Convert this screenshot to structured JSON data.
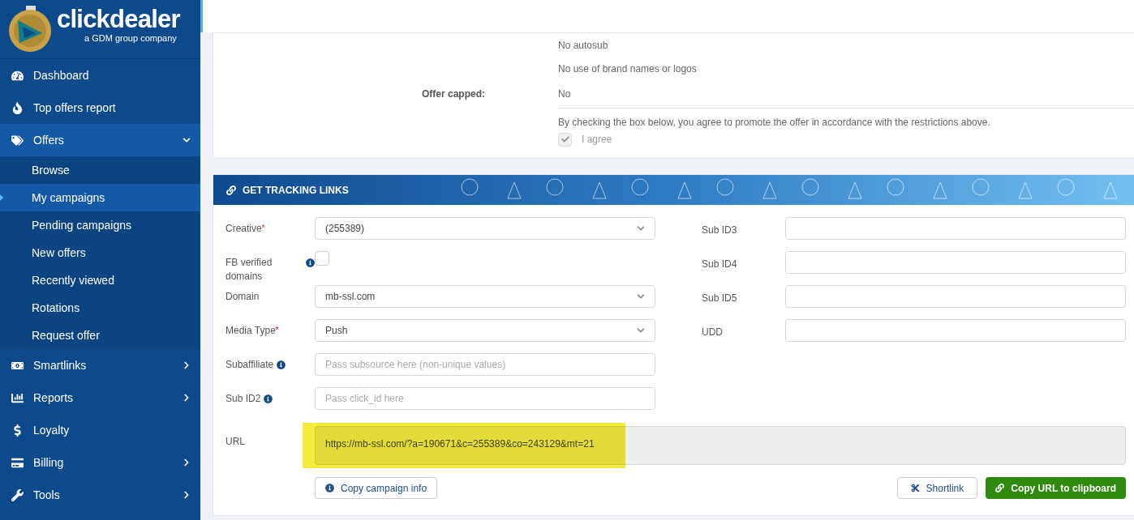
{
  "sidebar": {
    "logo": {
      "name": "clickdealer",
      "tagline": "a GDM group company"
    },
    "items": [
      {
        "label": "Dashboard",
        "kind": "link"
      },
      {
        "label": "Top offers report",
        "kind": "link"
      },
      {
        "label": "Offers",
        "kind": "group",
        "expanded": true,
        "children": [
          {
            "label": "Browse",
            "selected": false
          },
          {
            "label": "My campaigns",
            "selected": true
          },
          {
            "label": "Pending campaigns",
            "selected": false
          },
          {
            "label": "New offers",
            "selected": false
          },
          {
            "label": "Recently viewed",
            "selected": false
          },
          {
            "label": "Rotations",
            "selected": false
          },
          {
            "label": "Request offer",
            "selected": false
          }
        ]
      },
      {
        "label": "Smartlinks",
        "kind": "group",
        "expanded": false
      },
      {
        "label": "Reports",
        "kind": "group",
        "expanded": false
      },
      {
        "label": "Loyalty",
        "kind": "link"
      },
      {
        "label": "Billing",
        "kind": "group",
        "expanded": false
      },
      {
        "label": "Tools",
        "kind": "group",
        "expanded": false
      }
    ]
  },
  "offer_details": {
    "restrictions": [
      "No autosub",
      "No use of brand names or logos"
    ],
    "offer_capped": {
      "label": "Offer capped:",
      "value": "No"
    },
    "agreement": {
      "text": "By checking the box below, you agree to promote the offer in accordance with the restrictions above.",
      "checkbox_label": "I agree",
      "checked": true,
      "disabled": true
    }
  },
  "tracking_links": {
    "title": "GET TRACKING LINKS",
    "left_fields": [
      {
        "label": "Creative",
        "kind": "select",
        "required_mark": "*",
        "value": "(255389)"
      },
      {
        "label": "FB verified domains",
        "kind": "checkbox",
        "info": true,
        "checked": false
      },
      {
        "label": "Domain",
        "kind": "select",
        "value": "mb-ssl.com"
      },
      {
        "label": "Media Type",
        "kind": "select",
        "required_mark": "*",
        "value": "Push"
      },
      {
        "label": "Subaffiliate",
        "kind": "input",
        "info": true,
        "placeholder": "Pass subsource here (non-unique values)"
      },
      {
        "label": "Sub ID2",
        "kind": "input",
        "info": true,
        "placeholder": "Pass click_id here"
      }
    ],
    "right_fields": [
      {
        "label": "Sub ID3"
      },
      {
        "label": "Sub ID4"
      },
      {
        "label": "Sub ID5"
      },
      {
        "label": "UDD"
      }
    ],
    "url": {
      "label": "URL",
      "value": "https://mb-ssl.com/?a=190671&c=255389&co=243129&mt=21",
      "highlighted": true
    },
    "buttons": [
      {
        "label": "Copy campaign info",
        "kind": "info"
      },
      {
        "label": "Shortlink",
        "kind": "shortlink"
      },
      {
        "label": "Copy URL to clipboard",
        "kind": "copy"
      }
    ]
  }
}
